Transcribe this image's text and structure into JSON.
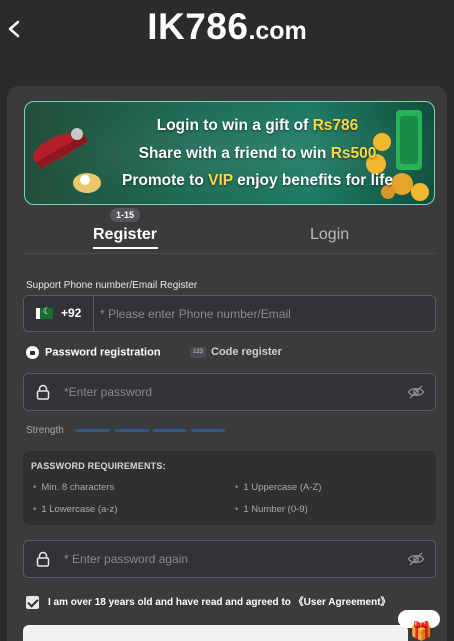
{
  "header": {
    "brand_main": "IK786",
    "brand_suffix": ".com"
  },
  "banner": {
    "line1_prefix": "Login to win a gift of ",
    "line1_highlight": "Rs786",
    "line2_prefix": "Share with a friend to win ",
    "line2_highlight": "Rs500",
    "line3_prefix": "Promote to ",
    "line3_highlight": "VIP",
    "line3_suffix": " enjoy benefits for life",
    "highlight_color": "#ffd447"
  },
  "tabs": {
    "badge": "1-15",
    "register": "Register",
    "login": "Login",
    "active": "Register"
  },
  "form": {
    "phone_label": "Support Phone number/Email Register",
    "country_code": "+92",
    "phone_placeholder": "* Please enter Phone number/Email",
    "mode_password": "Password registration",
    "mode_code": "Code register",
    "code_icon_text": "123",
    "password_placeholder": "*Enter password",
    "strength_label": "Strength",
    "requirements_title": "PASSWORD REQUIREMENTS:",
    "requirements": [
      "Min. 8 characters",
      "1 Uppercase (A-Z)",
      "1 Lowercase (a-z)",
      "1 Number (0-9)"
    ],
    "password_again_placeholder": "* Enter password again",
    "agree_text": "I am over 18 years old and have read and agreed to 《User Agreement》",
    "agree_checked": true
  },
  "colors": {
    "background": "#2a2b2d",
    "panel": "#3a3b3d",
    "strength_bar": "#2f5a86"
  }
}
